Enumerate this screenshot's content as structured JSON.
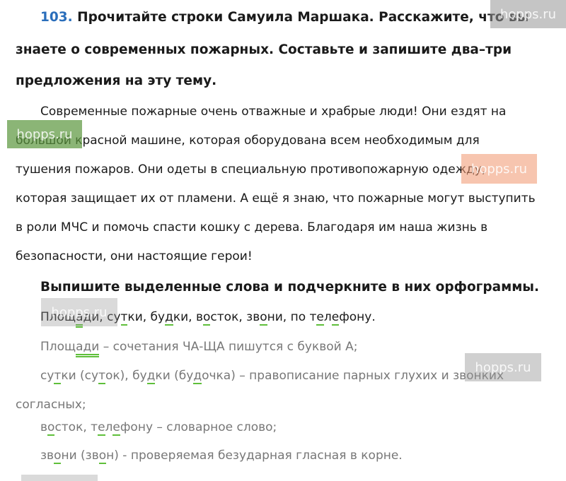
{
  "task": {
    "number": "103.",
    "text_l1": "Прочитайте строки Самуила Маршака. Расскажите, что вы",
    "text_l2": "знаете о современных пожарных. Составьте и запишите два–три",
    "text_l3": "предложения на эту тему."
  },
  "answer_text": {
    "l1": "Современные пожарные очень отважные и храбрые люди! Они ездят на",
    "l2": "большой красной машине, которая оборудована всем необходимым для",
    "l3": "тушения пожаров. Они одеты в специальную противопожарную одежду,",
    "l4": "которая защищает их от пламени. А ещё я знаю, что пожарные могут выступить",
    "l5": "в роли МЧС и помочь спасти кошку с дерева. Благодаря им наша жизнь в",
    "l6": "безопасности, они настоящие герои!"
  },
  "subtask": {
    "heading": "Выпишите выделенные слова и подчеркните в них орфограммы.",
    "words": {
      "w1a": "Площ",
      "w1b": "а",
      "w1c": "ди, су",
      "w1d": "т",
      "w1e": "ки, бу",
      "w1f": "д",
      "w1g": "ки, в",
      "w1h": "о",
      "w1i": "сток, зв",
      "w1j": "о",
      "w1k": "ни, по т",
      "w1l": "е",
      "w1m": "л",
      "w1n": "е",
      "w1o": "фону."
    }
  },
  "explanations": {
    "e1a": "Площ",
    "e1b": "ади",
    "e1c": " – сочетания ЧА-ЩА пишутся с буквой А;",
    "e2a": "су",
    "e2b": "т",
    "e2c": "ки (су",
    "e2d": "т",
    "e2e": "ок), бу",
    "e2f": "д",
    "e2g": "ки (бу",
    "e2h": "д",
    "e2i": "очка) – правописание парных глухих и звонких",
    "e3": "согласных;",
    "e4a": "в",
    "e4b": "о",
    "e4c": "сток, т",
    "e4d": "е",
    "e4e": "л",
    "e4f": "е",
    "e4g": "фону – словарное слово;",
    "e5a": "зв",
    "e5b": "о",
    "e5c": "ни (зв",
    "e5d": "о",
    "e5e": "н) - проверяемая безударная гласная в корне."
  },
  "watermark": "hopps.ru",
  "colors": {
    "number": "#2a6ebb",
    "underline": "#5fbf3a",
    "gray_text": "#777777"
  }
}
